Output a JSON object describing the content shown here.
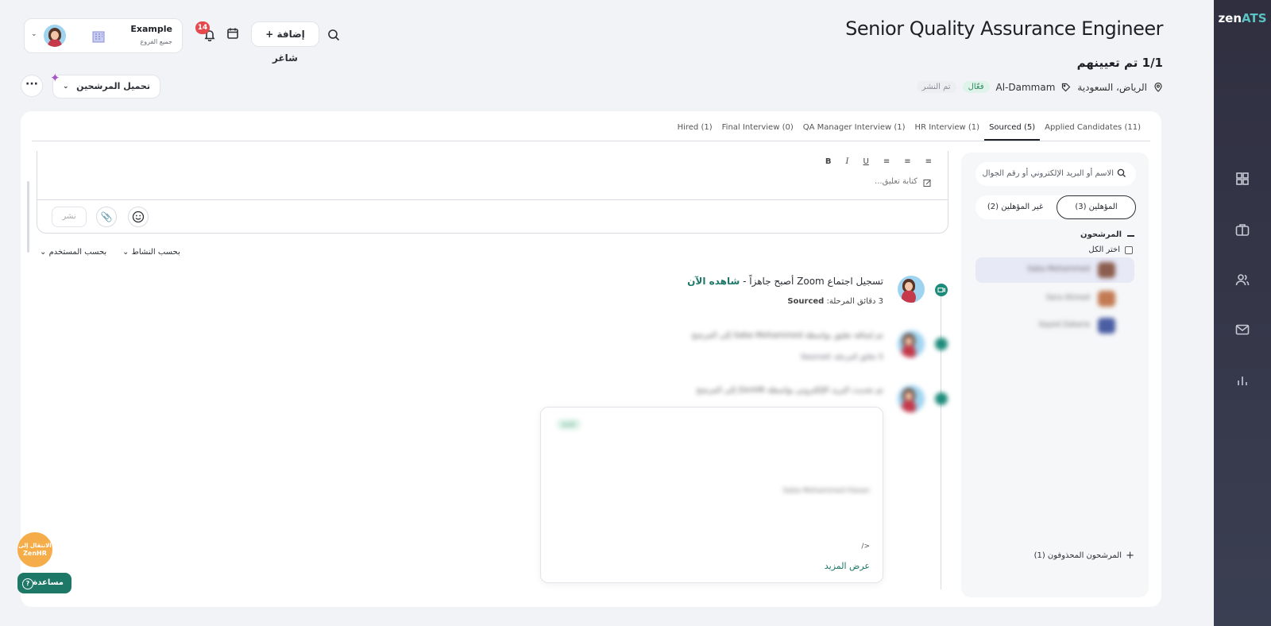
{
  "app": {
    "logo_zen": "zen",
    "logo_ats": "ATS"
  },
  "header": {
    "job_title": "Senior Quality Assurance Engineer",
    "hired_count": "1/1 تم تعيينهم",
    "location": "الرياض، السعودية",
    "branch": "Al-Dammam",
    "status_active": "فعّال",
    "status_published": "تم النشر"
  },
  "top_bar": {
    "company_name": "Example",
    "branches_label": "جميع الفروع",
    "notifications_count": "14",
    "add_vacancy_label": "+ إضافة شاغر",
    "upload_candidates_label": "تحميل المرشحين"
  },
  "tabs": [
    {
      "label": "(11) Applied Candidates"
    },
    {
      "label": "(5) Sourced"
    },
    {
      "label": "(1) HR Interview"
    },
    {
      "label": "(1) QA Manager Interview"
    },
    {
      "label": "(0) Final Interview"
    },
    {
      "label": "(1) Hired"
    }
  ],
  "candidates_panel": {
    "search_placeholder": "الاسم أو البريد الإلكتروني أو رقم الجوال",
    "qualified_label": "المؤهلين (3)",
    "unqualified_label": "غير المؤهلين (2)",
    "group_label": "المرشحون",
    "select_all_label": "اختر الكل",
    "deleted_label": "المرشحون المحذوفون (1)",
    "candidate_names": [
      "Saba Mohammed",
      "Sara Ahmed",
      "Sayed Zakaria"
    ]
  },
  "editor": {
    "placeholder": "كتابة تعليق...",
    "publish_label": "نشر"
  },
  "filters": {
    "by_activity": "بحسب النشاط",
    "by_user": "بحسب المستخدم"
  },
  "feed": {
    "post1_text": "تسجيل اجتماع Zoom أصبح جاهزاً - ",
    "post1_link": "شاهده الآن",
    "post1_meta": "3 دقائق المرحلة: ",
    "post1_stage": "Sourced",
    "post2_text": "تم إضافة تعليق بواسطة Saba Mohammed إلى المرشح",
    "post2_meta": "5 دقائق المرحلة: Sourced",
    "post3_text": "تم تحديث البريد الإلكتروني بواسطة ZenHR إلى المرشح",
    "card_badge": "جديد",
    "card_name": "Saba Mohammed Hasan",
    "card_code": "/>",
    "show_more_label": "عرض المزيد"
  },
  "floating": {
    "switch_label_line1": "الانتقال إلى",
    "switch_label_line2": "ZenHR",
    "help_label": "مساعدة"
  }
}
